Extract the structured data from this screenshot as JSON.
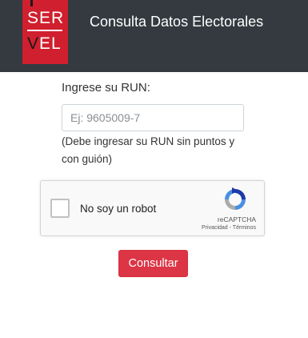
{
  "header": {
    "logo_line1": "SER",
    "logo_line2_v": "V",
    "logo_line2_rest": "EL",
    "title": "Consulta Datos Electorales"
  },
  "form": {
    "run_label": "Ingrese su RUN:",
    "run_placeholder": "Ej: 9605009-7",
    "run_value": "",
    "run_help": "(Debe ingresar su RUN sin puntos y con guión)",
    "submit_label": "Consultar"
  },
  "recaptcha": {
    "label": "No soy un robot",
    "brand": "reCAPTCHA",
    "links": "Privacidad - Términos",
    "checked": false
  },
  "colors": {
    "header_bg": "#343a40",
    "logo_red": "#d01f2e",
    "button_red": "#dc3545"
  }
}
